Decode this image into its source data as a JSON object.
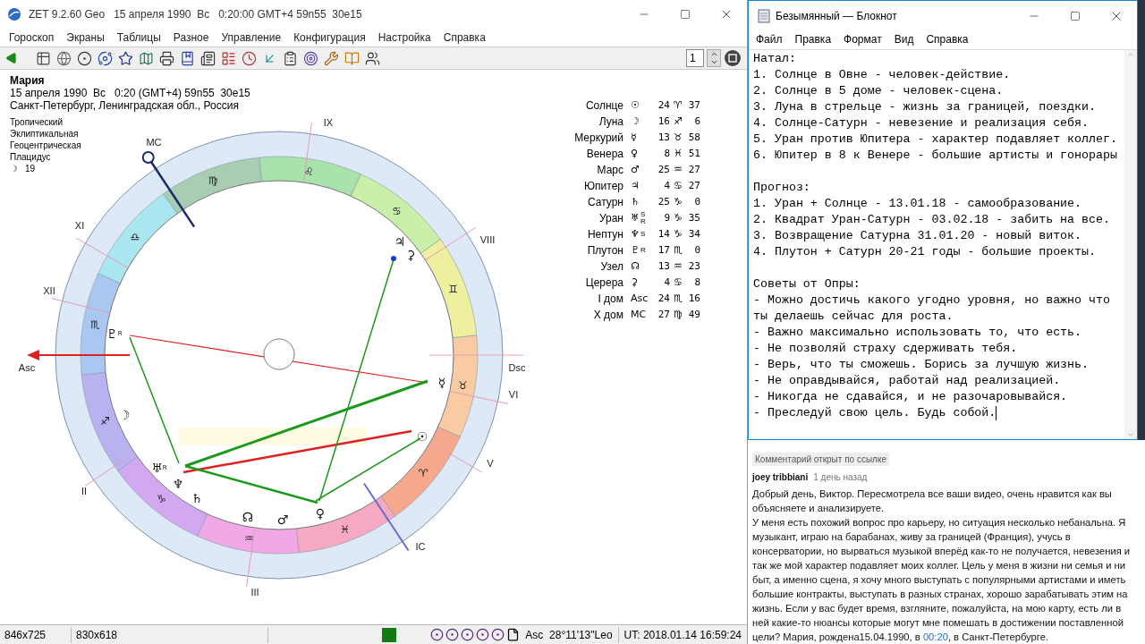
{
  "zet_window": {
    "title": "ZET 9.2.60 Geo   15 апреля 1990  Вс   0:20:00 GMT+4 59n55  30e15",
    "menu": [
      "Гороскоп",
      "Экраны",
      "Таблицы",
      "Разное",
      "Управление",
      "Конфигурация",
      "Настройка",
      "Справка"
    ],
    "page_spin": "1",
    "status_bar": {
      "size_1": "846x725",
      "size_2": "830x618",
      "asc_position": "Asc  28°11'13\"Leo",
      "ut_time": "UT: 2018.01.14 16:59:24"
    }
  },
  "chart_info": {
    "name": "Мария",
    "date_line": "15 апреля 1990  Вс   0:20 (GMT+4) 59n55  30e15",
    "place": "Санкт-Петербург, Ленинградская обл., Россия",
    "settings": [
      "Тропический",
      "Эклиптикальная",
      "Геоцентрическая",
      "Плацидус"
    ],
    "moon_day": {
      "glyph": "☽",
      "value": "19"
    }
  },
  "planets": [
    {
      "name": "Солнце",
      "glyph": "☉",
      "degree": "24",
      "sign": "♈",
      "minutes": "37"
    },
    {
      "name": "Луна",
      "glyph": "☽",
      "degree": "16",
      "sign": "♐",
      "minutes": "6"
    },
    {
      "name": "Меркурий",
      "glyph": "☿",
      "degree": "13",
      "sign": "♉",
      "minutes": "58"
    },
    {
      "name": "Венера",
      "glyph": "♀",
      "degree": "8",
      "sign": "♓",
      "minutes": "51"
    },
    {
      "name": "Марс",
      "glyph": "♂",
      "degree": "25",
      "sign": "♒",
      "minutes": "27"
    },
    {
      "name": "Юпитер",
      "glyph": "♃",
      "degree": "4",
      "sign": "♋",
      "minutes": "27"
    },
    {
      "name": "Сатурн",
      "glyph": "♄",
      "degree": "25",
      "sign": "♑",
      "minutes": "0"
    },
    {
      "name": "Уран",
      "glyph": "♅",
      "notes": [
        "S",
        "R"
      ],
      "degree": "9",
      "sign": "♑",
      "minutes": "35"
    },
    {
      "name": "Нептун",
      "glyph": "♆",
      "notes": [
        "S"
      ],
      "degree": "14",
      "sign": "♑",
      "minutes": "34"
    },
    {
      "name": "Плутон",
      "glyph": "♇",
      "notes": [
        "R"
      ],
      "degree": "17",
      "sign": "♏",
      "minutes": "0"
    },
    {
      "name": "Узел",
      "glyph": "☊",
      "degree": "13",
      "sign": "♒",
      "minutes": "23"
    },
    {
      "name": "Церера",
      "glyph": "⚳",
      "degree": "4",
      "sign": "♋",
      "minutes": "8"
    },
    {
      "name": "I дом",
      "glyph": "Asc",
      "degree": "24",
      "sign": "♏",
      "minutes": "16"
    },
    {
      "name": "X дом",
      "glyph": "MC",
      "degree": "27",
      "sign": "♍",
      "minutes": "49"
    }
  ],
  "wheel": {
    "house_labels": [
      "MC",
      "IX",
      "XI",
      "VIII",
      "XII",
      "Asc",
      "Dsc",
      "VI",
      "V",
      "II",
      "IC",
      "III"
    ],
    "signs": [
      "♈",
      "♉",
      "♊",
      "♋",
      "♌",
      "♍",
      "♎",
      "♏",
      "♐",
      "♑",
      "♒",
      "♓"
    ],
    "planet_marks": [
      {
        "glyph": "☉"
      },
      {
        "glyph": "☽"
      },
      {
        "glyph": "☿"
      },
      {
        "glyph": "♀"
      },
      {
        "glyph": "♂"
      },
      {
        "glyph": "♃"
      },
      {
        "glyph": "♄"
      },
      {
        "glyph": "♅",
        "note": "R"
      },
      {
        "glyph": "♆"
      },
      {
        "glyph": "♇",
        "note": "R"
      },
      {
        "glyph": "☊"
      },
      {
        "glyph": "⚳"
      }
    ]
  },
  "notepad": {
    "title": "Безымянный — Блокнот",
    "menu": [
      "Файл",
      "Правка",
      "Формат",
      "Вид",
      "Справка"
    ],
    "sections": [
      [
        "Натал:",
        "1. Солнце в Овне - человек-действие.",
        "2. Солнце в 5 доме - человек-сцена.",
        "3. Луна в стрельце - жизнь за границей, поездки.",
        "4. Солнце-Сатурн - невезение и реализация себя.",
        "5. Уран против Юпитера - характер подавляет коллег.",
        "6. Юпитер в 8 к Венере - большие артисты и гонорары"
      ],
      [
        "Прогноз:",
        "1. Уран + Солнце - 13.01.18 - самообразование.",
        "2. Квадрат Уран-Сатурн - 03.02.18 - забить на все.",
        "3. Возвращение Сатурна 31.01.20 - новый виток.",
        "4. Плутон + Сатурн 20-21 годы - большие проекты."
      ],
      [
        "Советы от Опры:",
        "- Можно достичь какого угодно уровня, но важно что",
        "ты делаешь сейчас для роста.",
        "- Важно максимально использовать то, что есть.",
        "- Не позволяй страху сдерживать тебя.",
        "- Верь, что ты сможешь. Борись за лучшую жизнь.",
        "- Не оправдывайся, работай над реализацией.",
        "- Никогда не сдавайся, и не разочаровывайся.",
        "- Преследуй свою цель. Будь собой."
      ]
    ]
  },
  "comment": {
    "notice": "Комментарий открыт по ссылке",
    "author": "joey tribbiani",
    "time": "1 день назад",
    "paragraph_1": "Добрый день, Виктор. Пересмотрела все ваши видео, очень нравится как вы объясняете и анализируете.",
    "paragraph_2": {
      "before": "У меня есть похожий вопрос про карьеру, но ситуация несколько небанальна. Я музыкант, играю на барабанах, живу за границей (Франция), учусь в консерватории, но вырваться музыкой вперёд как-то не получается, невезения и так же мой характер подавляет моих коллег. Цель у меня в жизни ни семья и ни быт, а именно сцена, я хочу много выступать с популярными артистами и иметь большие контракты, выступать в разных странах, хорошо зарабатывать этим на жизнь. Если у вас будет время, взгляните, пожалуйста, на мою карту, есть ли в ней какие-то нюансы которые могут мне помешать в достижении поставленной цели? Мария, рождена15.04.1990, в ",
      "link": "00:20",
      "after": ", в Санкт-Петербурге."
    }
  }
}
